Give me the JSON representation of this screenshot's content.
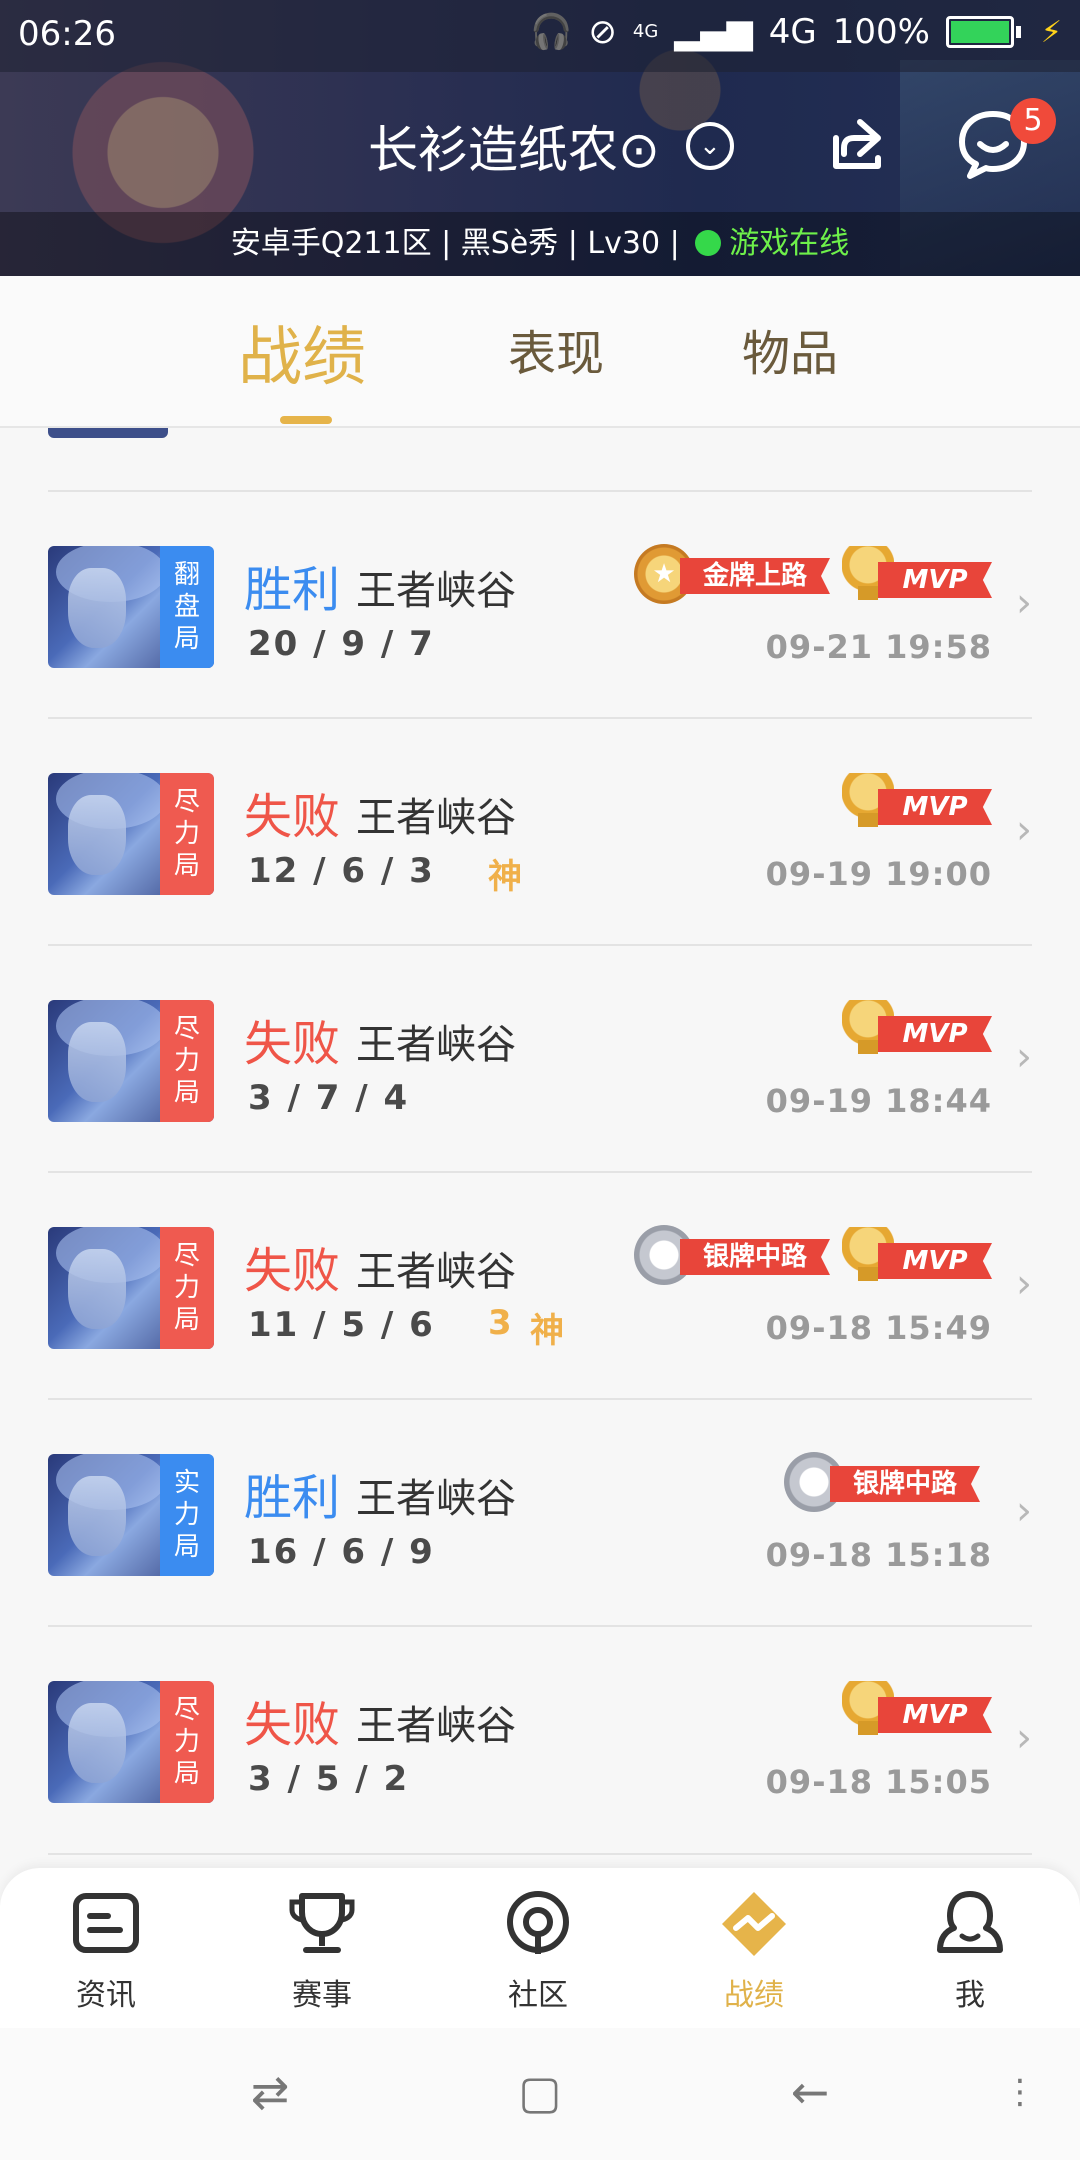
{
  "status_bar": {
    "time": "06:26",
    "network_small": "4G",
    "network": "4G",
    "battery": "100%",
    "battery_level": 1.0
  },
  "profile": {
    "name": "长衫造纸农⊙",
    "unread_messages": "5",
    "info": "安卓手Q211区 | 黑Sè秀 | Lv30 |",
    "online_status": "游戏在线"
  },
  "tabs": [
    {
      "label": "战绩",
      "active": true
    },
    {
      "label": "表现",
      "active": false
    },
    {
      "label": "物品",
      "active": false
    }
  ],
  "matches": [
    {
      "result": "胜利",
      "result_type": "win",
      "tag": [
        "翻",
        "盘",
        "局"
      ],
      "tag_color": "blue",
      "mode": "王者峡谷",
      "kda": "20 / 9 / 7",
      "extras": [],
      "medal": {
        "type": "gold",
        "label": "金牌上路"
      },
      "mvp": "MVP",
      "date": "09-21 19:58"
    },
    {
      "result": "失败",
      "result_type": "lose",
      "tag": [
        "尽",
        "力",
        "局"
      ],
      "tag_color": "red",
      "mode": "王者峡谷",
      "kda": "12 / 6 / 3",
      "extras": [
        "神"
      ],
      "medal": null,
      "mvp": "MVP",
      "date": "09-19 19:00"
    },
    {
      "result": "失败",
      "result_type": "lose",
      "tag": [
        "尽",
        "力",
        "局"
      ],
      "tag_color": "red",
      "mode": "王者峡谷",
      "kda": "3 / 7 / 4",
      "extras": [],
      "medal": null,
      "mvp": "MVP",
      "date": "09-19 18:44"
    },
    {
      "result": "失败",
      "result_type": "lose",
      "tag": [
        "尽",
        "力",
        "局"
      ],
      "tag_color": "red",
      "mode": "王者峡谷",
      "kda": "11 / 5 / 6",
      "extras": [
        "3",
        "神"
      ],
      "medal": {
        "type": "silver",
        "label": "银牌中路"
      },
      "mvp": "MVP",
      "date": "09-18 15:49"
    },
    {
      "result": "胜利",
      "result_type": "win",
      "tag": [
        "实",
        "力",
        "局"
      ],
      "tag_color": "blue",
      "mode": "王者峡谷",
      "kda": "16 / 6 / 9",
      "extras": [],
      "medal": {
        "type": "silver",
        "label": "银牌中路"
      },
      "mvp": null,
      "date": "09-18 15:18"
    },
    {
      "result": "失败",
      "result_type": "lose",
      "tag": [
        "尽",
        "力",
        "局"
      ],
      "tag_color": "red",
      "mode": "王者峡谷",
      "kda": "3 / 5 / 2",
      "extras": [],
      "medal": null,
      "mvp": "MVP",
      "date": "09-18 15:05"
    }
  ],
  "bottom_nav": [
    {
      "label": "资讯",
      "icon": "news-icon",
      "active": false
    },
    {
      "label": "赛事",
      "icon": "trophy-icon",
      "active": false
    },
    {
      "label": "社区",
      "icon": "community-icon",
      "active": false
    },
    {
      "label": "战绩",
      "icon": "record-icon",
      "active": true
    },
    {
      "label": "我",
      "icon": "profile-icon",
      "active": false
    }
  ],
  "colors": {
    "accent_gold": "#e0b24a",
    "win_blue": "#3b8cf0",
    "lose_red": "#ef5548",
    "online_green": "#35d84a"
  }
}
